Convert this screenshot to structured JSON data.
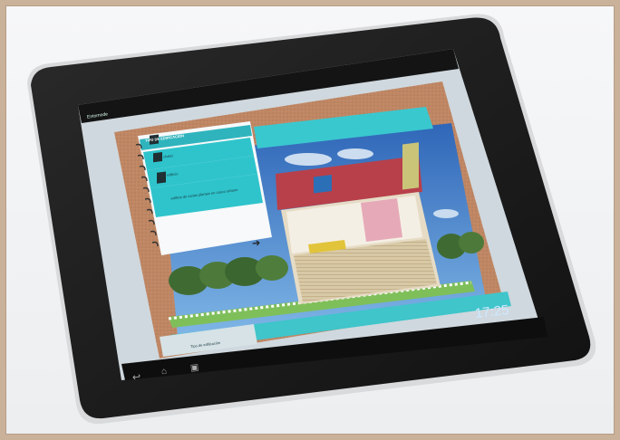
{
  "app_bar": {
    "title": "Entornode"
  },
  "panel": {
    "heading": "TIPO DE EDIFICACIÓN",
    "options": [
      {
        "label": "chalet",
        "icon": "house-icon"
      },
      {
        "label": "edificio",
        "icon": "building-icon"
      },
      {
        "label": "edificio de varias plantas en casco urbano",
        "icon": "tower-icon"
      }
    ],
    "next_icon": "arrow-right-icon"
  },
  "bottom_strip": {
    "label": "Tipo de edificación"
  },
  "status_bar": {
    "time": "17:25"
  },
  "nav_icons": [
    "back-icon",
    "home-icon",
    "recent-apps-icon"
  ],
  "colors": {
    "accent": "#2fc4cc",
    "cork": "#c98f6a",
    "bezel": "#1c1c1c",
    "sky": "#3f86c9"
  }
}
